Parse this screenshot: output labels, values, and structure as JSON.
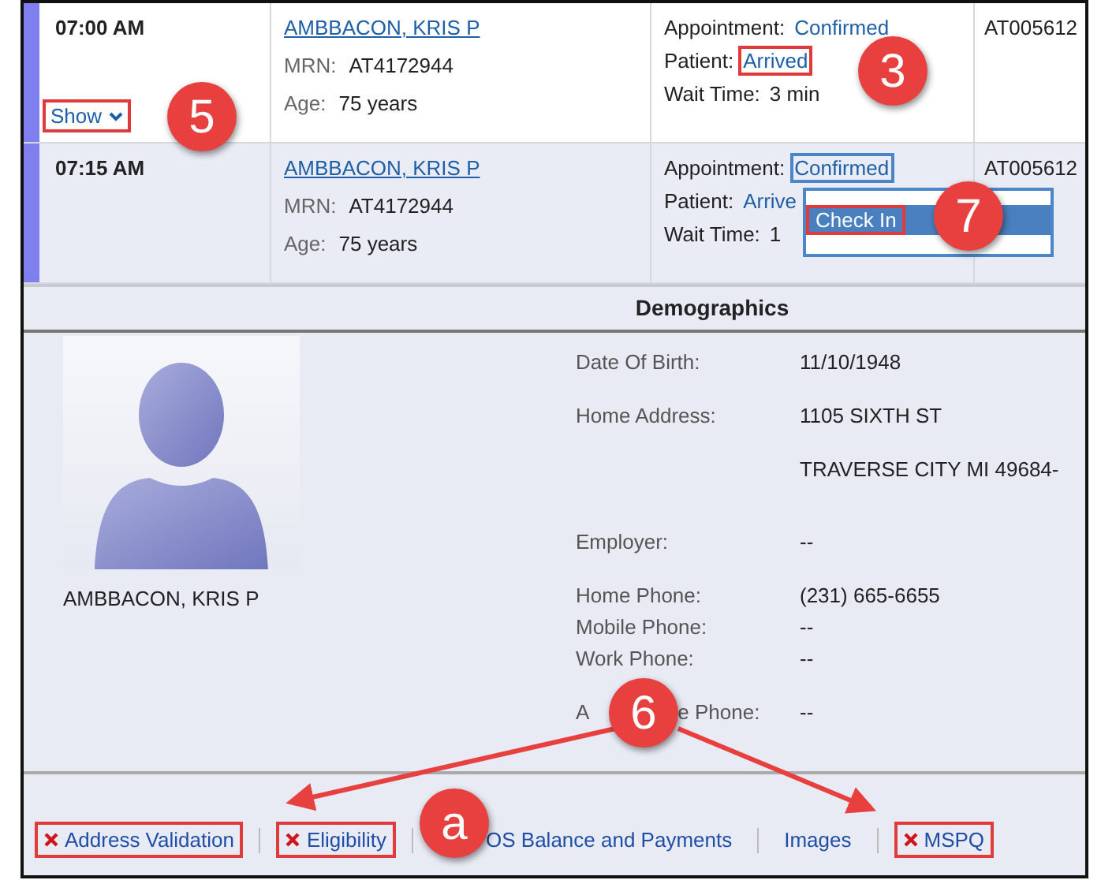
{
  "appointments": [
    {
      "time": "07:00 AM",
      "show_toggle": {
        "label": "Show",
        "highlighted": true
      },
      "patient": {
        "name": "AMBBACON, KRIS P",
        "mrn_label": "MRN:",
        "mrn": "AT4172944",
        "age_label": "Age:",
        "age": "75 years"
      },
      "status": [
        {
          "label": "Appointment:",
          "value": "Confirmed",
          "link": true,
          "highlighted": false,
          "focused": false
        },
        {
          "label": "Patient:",
          "value": "Arrived",
          "link": true,
          "highlighted": true,
          "focused": false
        },
        {
          "label": "Wait Time:",
          "value": "3 min",
          "link": false,
          "highlighted": false,
          "focused": false
        }
      ],
      "column_4": "AT005612"
    },
    {
      "time": "07:15 AM",
      "patient": {
        "name": "AMBBACON, KRIS P",
        "mrn_label": "MRN:",
        "mrn": "AT4172944",
        "age_label": "Age:",
        "age": "75 years"
      },
      "status": [
        {
          "label": "Appointment:",
          "value": "Confirmed",
          "link": true,
          "highlighted": false,
          "focused": true
        },
        {
          "label": "Patient:",
          "value": "Arrive",
          "link": true,
          "highlighted": false,
          "focused": false
        },
        {
          "label": "Wait Time:",
          "value": "1",
          "link": false,
          "highlighted": false,
          "focused": false
        }
      ],
      "menu": {
        "items": [
          {
            "label": "Check In",
            "selected": true,
            "highlighted": true
          }
        ]
      },
      "column_4": "AT005612"
    }
  ],
  "demographics": {
    "title": "Demographics",
    "name": "AMBBACON, KRIS P",
    "field_groups": [
      [
        {
          "label": "Date Of Birth:",
          "values": [
            "11/10/1948"
          ]
        }
      ],
      [
        {
          "label": "Home Address:",
          "values": [
            "1105 SIXTH ST",
            "TRAVERSE CITY MI 49684-"
          ]
        }
      ],
      [
        {
          "label": "Employer:",
          "values": [
            "--"
          ]
        }
      ],
      [
        {
          "label": "Home Phone:",
          "values": [
            "(231) 665-6655"
          ]
        },
        {
          "label": "Mobile Phone:",
          "values": [
            "--"
          ]
        },
        {
          "label": "Work Phone:",
          "values": [
            "--"
          ]
        }
      ],
      [
        {
          "label_parts": [
            "A",
            "e Phone:"
          ],
          "values": [
            "--"
          ]
        }
      ]
    ]
  },
  "footer_links": [
    {
      "label": "Address Validation",
      "flagged": true,
      "highlighted": true
    },
    {
      "label": "Eligibility",
      "flagged": true,
      "highlighted": true
    },
    {
      "label": "OS Balance and Payments",
      "flagged": false,
      "highlighted": false
    },
    {
      "label": "Images",
      "flagged": false,
      "highlighted": false
    },
    {
      "label": "MSPQ",
      "flagged": true,
      "highlighted": true
    }
  ],
  "callouts": [
    {
      "label": "3"
    },
    {
      "label": "5"
    },
    {
      "label": "7"
    },
    {
      "label": "6"
    },
    {
      "label": "a"
    }
  ]
}
